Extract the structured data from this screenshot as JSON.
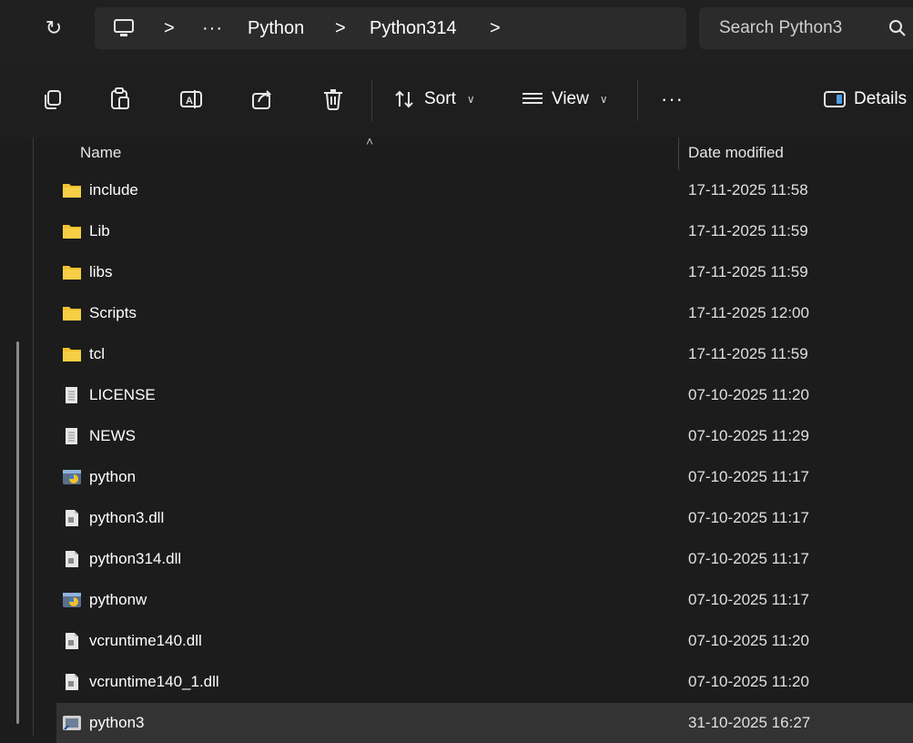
{
  "address": {
    "refresh_icon": "refresh-icon",
    "pc_icon": "computer-icon",
    "overflow": "···",
    "crumbs": [
      "Python",
      "Python314"
    ],
    "separator": ">"
  },
  "search": {
    "placeholder": "Search Python3",
    "icon": "search-icon"
  },
  "toolbar": {
    "sort_label": "Sort",
    "view_label": "View",
    "more_label": "···",
    "details_label": "Details"
  },
  "columns": {
    "name": "Name",
    "date": "Date modified"
  },
  "files": [
    {
      "name": "include",
      "date": "17-11-2025 11:58",
      "type": "folder"
    },
    {
      "name": "Lib",
      "date": "17-11-2025 11:59",
      "type": "folder"
    },
    {
      "name": "libs",
      "date": "17-11-2025 11:59",
      "type": "folder"
    },
    {
      "name": "Scripts",
      "date": "17-11-2025 12:00",
      "type": "folder"
    },
    {
      "name": "tcl",
      "date": "17-11-2025 11:59",
      "type": "folder"
    },
    {
      "name": "LICENSE",
      "date": "07-10-2025 11:20",
      "type": "text"
    },
    {
      "name": "NEWS",
      "date": "07-10-2025 11:29",
      "type": "text"
    },
    {
      "name": "python",
      "date": "07-10-2025 11:17",
      "type": "python-exe"
    },
    {
      "name": "python3.dll",
      "date": "07-10-2025 11:17",
      "type": "dll"
    },
    {
      "name": "python314.dll",
      "date": "07-10-2025 11:17",
      "type": "dll"
    },
    {
      "name": "pythonw",
      "date": "07-10-2025 11:17",
      "type": "python-exe"
    },
    {
      "name": "vcruntime140.dll",
      "date": "07-10-2025 11:20",
      "type": "dll"
    },
    {
      "name": "vcruntime140_1.dll",
      "date": "07-10-2025 11:20",
      "type": "dll"
    },
    {
      "name": "python3",
      "date": "31-10-2025 16:27",
      "type": "shortcut",
      "selected": true
    }
  ],
  "colors": {
    "folder": "#f2c12e",
    "accent": "#4c9be8",
    "selected_row": "#333333"
  }
}
